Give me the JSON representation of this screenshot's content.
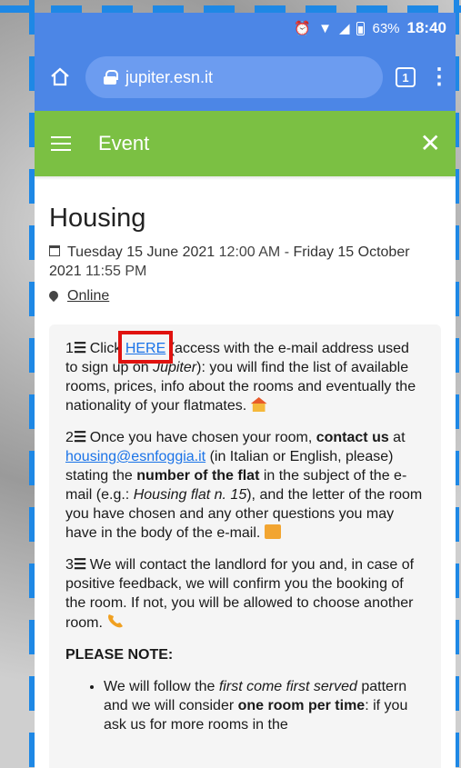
{
  "status_bar": {
    "battery": "63%",
    "time": "18:40"
  },
  "browser": {
    "url": "jupiter.esn.it",
    "tab_count": "1"
  },
  "header": {
    "title": "Event"
  },
  "event": {
    "title": "Housing",
    "date_start_day": "Tuesday 15 June 2021",
    "date_start_time": "12:00 AM",
    "date_sep": " - ",
    "date_end_day": "Friday 15 October 2021",
    "date_end_time": "11:55 PM",
    "location": "Online"
  },
  "body": {
    "step1_num": "1",
    "step1_pre": " Click ",
    "step1_link": "HERE",
    "step1_a": " (access with the e-mail address used to sign up on ",
    "step1_em": "Jupiter",
    "step1_b": "): you will find the list of available rooms, prices, info about the rooms and eventually the nationality of your flatmates.",
    "step2_num": "2",
    "step2_a": " Once you have chosen your room, ",
    "step2_bold1": "contact us",
    "step2_b": " at ",
    "step2_link": "housing@esnfoggia.it",
    "step2_c": " (in Italian or English, please) stating the ",
    "step2_bold2": "number of the flat",
    "step2_d": " in the subject of the e-mail (e.g.: ",
    "step2_em": "Housing flat n. 15",
    "step2_e": "), and the letter of the room you have chosen and any other questions you may have in the body of the e-mail.",
    "step3_num": "3",
    "step3_text": " We will contact the landlord for you and, in case of positive feedback, we will confirm you the booking of the room. If not, you will be allowed to choose another room.",
    "note_label": "PLEASE NOTE:",
    "bullet1_a": "We will follow the ",
    "bullet1_em": "first come first served",
    "bullet1_b": " pattern and we will consider ",
    "bullet1_bold": "one room per time",
    "bullet1_c": ": if you ask us for more rooms in the"
  }
}
